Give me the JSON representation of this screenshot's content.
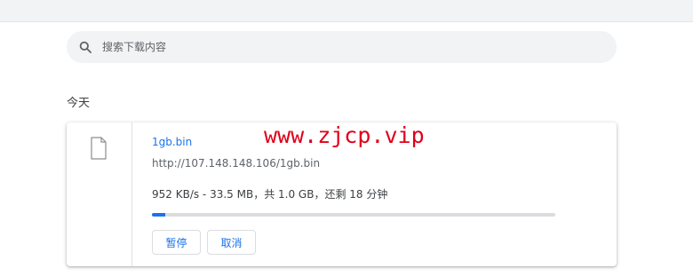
{
  "search": {
    "placeholder": "搜索下载内容"
  },
  "section": {
    "title": "今天"
  },
  "download": {
    "file_name": "1gb.bin",
    "url": "http://107.148.148.106/1gb.bin",
    "status": "952 KB/s - 33.5 MB，共 1.0 GB，还剩 18 分钟",
    "progress_percent": 3.3,
    "pause_label": "暂停",
    "cancel_label": "取消"
  },
  "watermark": {
    "text": "www.zjcp.vip"
  },
  "colors": {
    "accent": "#1a73e8",
    "watermark": "#e0001a",
    "search_bg": "#f1f3f4"
  },
  "icons": {
    "search": "search-icon",
    "file": "file-icon"
  }
}
